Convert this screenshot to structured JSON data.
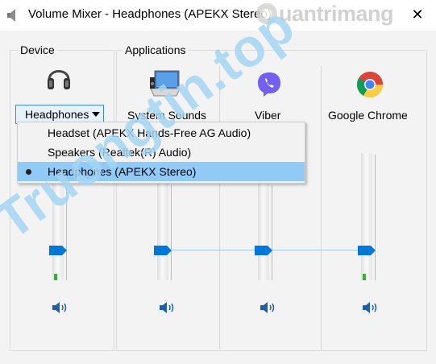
{
  "window": {
    "title": "Volume Mixer - Headphones (APEKX Stereo)",
    "close_glyph": "✕",
    "icon": "speaker-icon"
  },
  "watermark_top": {
    "text": "uantrimang"
  },
  "watermark_diag": {
    "text": "Truongtin.top"
  },
  "device": {
    "group_label": "Device",
    "icon": "headphones-icon",
    "selected_label": "Headphones"
  },
  "applications": {
    "group_label": "Applications",
    "items": [
      {
        "label": "System Sounds",
        "icon": "system-sounds-icon",
        "level": 0.45
      },
      {
        "label": "Viber",
        "icon": "viber-icon",
        "level": 0.45
      },
      {
        "label": "Google Chrome",
        "icon": "chrome-icon",
        "level": 0.45
      }
    ]
  },
  "device_menu": {
    "items": [
      {
        "label": "Headset (APEKX Hands-Free AG Audio)",
        "checked": false
      },
      {
        "label": "Speakers (Realtek(R) Audio)",
        "checked": false
      },
      {
        "label": "Headphones (APEKX Stereo)",
        "checked": true
      }
    ]
  },
  "colors": {
    "accent": "#0078d7",
    "menu_highlight": "#91c9f7",
    "level_green": "#33b533"
  }
}
